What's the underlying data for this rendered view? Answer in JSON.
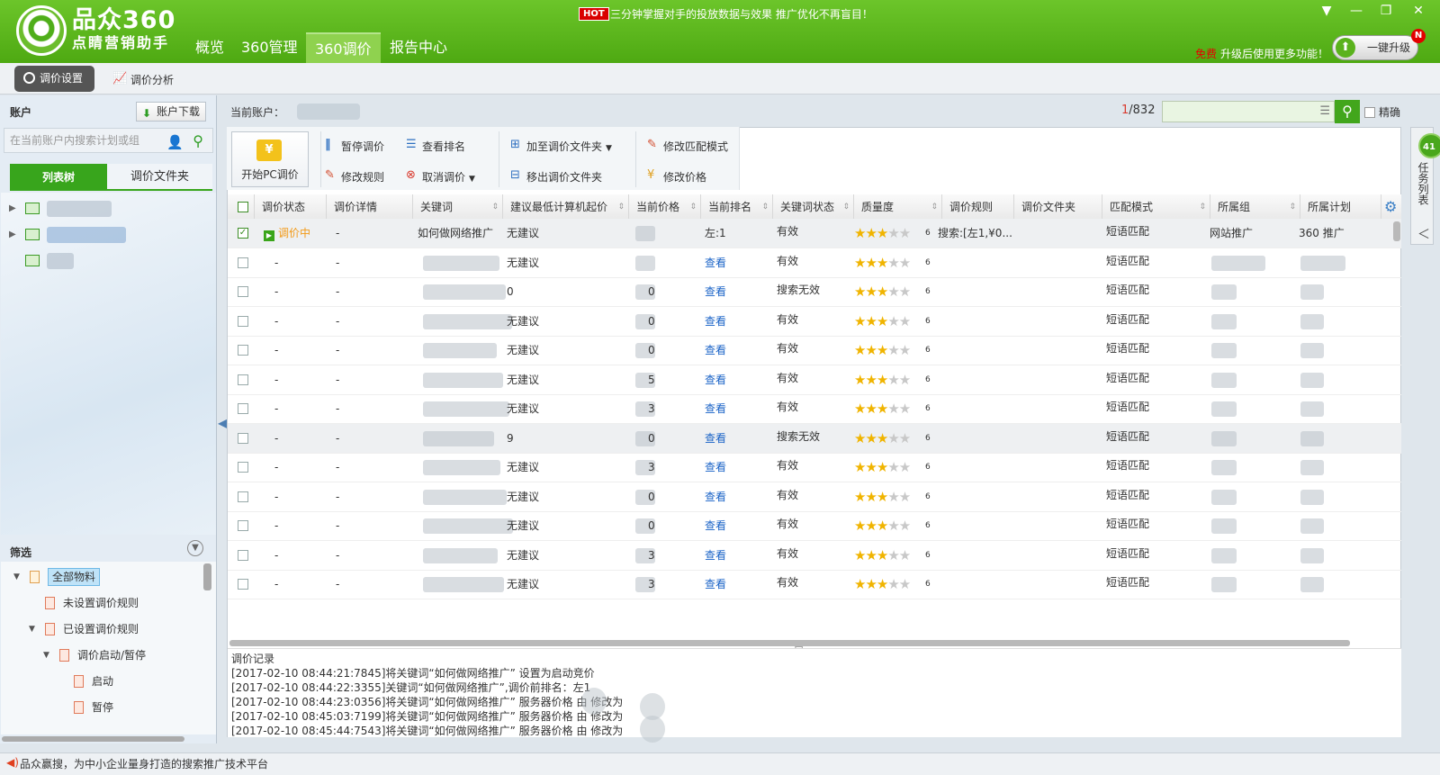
{
  "app": {
    "brand_name": "品众360",
    "brand_sub": "点睛营销助手",
    "nav_tabs": [
      "概览",
      "360管理",
      "360调价",
      "报告中心"
    ],
    "hot_badge": "HOT",
    "hot_text": "三分钟掌握对手的投放数据与效果  推广优化不再盲目！",
    "free_label": "免费",
    "upgrade_text": "升级后使用更多功能！",
    "upgrade_button": "一键升级",
    "upgrade_badge": "N"
  },
  "subtabs": [
    "调价设置",
    "调价分析"
  ],
  "left": {
    "account_title": "账户",
    "download_button": "账户下载",
    "search_placeholder": "在当前账户内搜索计划或组",
    "tab_list": "列表树",
    "tab_folder": "调价文件夹",
    "filter_title": "筛选",
    "filter_items": [
      {
        "label": "全部物料"
      },
      {
        "label": "未设置调价规则"
      },
      {
        "label": "已设置调价规则"
      },
      {
        "label": "调价启动/暂停"
      },
      {
        "label": "启动"
      },
      {
        "label": "暂停"
      }
    ]
  },
  "main": {
    "current_account_label": "当前账户：",
    "page_current": "1",
    "page_total": "/832",
    "precise_label": "精确",
    "toolbar": {
      "start_pc": "开始PC调价",
      "pause": "暂停调价",
      "view_rank": "查看排名",
      "add_folder": "加至调价文件夹",
      "modify_match": "修改匹配模式",
      "modify_rule": "修改规则",
      "cancel": "取消调价",
      "remove_folder": "移出调价文件夹",
      "modify_price": "修改价格"
    },
    "columns": [
      "调价状态",
      "调价详情",
      "关键词",
      "建议最低计算机起价",
      "当前价格",
      "当前排名",
      "关键词状态",
      "质量度",
      "调价规则",
      "调价文件夹",
      "匹配模式",
      "所属组",
      "所属计划"
    ],
    "rows": [
      {
        "checked": true,
        "status": "调价中",
        "detail": "-",
        "keyword": "如何做网络推广",
        "suggest": "无建议",
        "price": "",
        "rank": "左:1",
        "kw_state": "有效",
        "quality": 3,
        "q_num": "6",
        "rule": "搜索:[左1,¥0...",
        "match": "短语匹配",
        "group": "网站推广",
        "plan": "360 推广"
      },
      {
        "checked": false,
        "status": "-",
        "detail": "-",
        "keyword": "",
        "suggest": "无建议",
        "price": "",
        "rank": "查看",
        "kw_state": "有效",
        "quality": 3,
        "q_num": "6",
        "rule": "",
        "match": "短语匹配",
        "group": "",
        "plan": ""
      },
      {
        "checked": false,
        "status": "-",
        "detail": "-",
        "keyword": "",
        "suggest": "0",
        "price": "0",
        "rank": "查看",
        "kw_state": "搜索无效",
        "quality": 3,
        "q_num": "6",
        "rule": "",
        "match": "短语匹配",
        "group": "",
        "plan": ""
      },
      {
        "checked": false,
        "status": "-",
        "detail": "-",
        "keyword": "",
        "suggest": "无建议",
        "price": "0",
        "rank": "查看",
        "kw_state": "有效",
        "quality": 3,
        "q_num": "6",
        "rule": "",
        "match": "短语匹配",
        "group": "",
        "plan": ""
      },
      {
        "checked": false,
        "status": "-",
        "detail": "-",
        "keyword": "",
        "suggest": "无建议",
        "price": "0",
        "rank": "查看",
        "kw_state": "有效",
        "quality": 3,
        "q_num": "6",
        "rule": "",
        "match": "短语匹配",
        "group": "",
        "plan": ""
      },
      {
        "checked": false,
        "status": "-",
        "detail": "-",
        "keyword": "",
        "suggest": "无建议",
        "price": "5",
        "rank": "查看",
        "kw_state": "有效",
        "quality": 3,
        "q_num": "6",
        "rule": "",
        "match": "短语匹配",
        "group": "",
        "plan": ""
      },
      {
        "checked": false,
        "status": "-",
        "detail": "-",
        "keyword": "",
        "suggest": "无建议",
        "price": "3",
        "rank": "查看",
        "kw_state": "有效",
        "quality": 3,
        "q_num": "6",
        "rule": "",
        "match": "短语匹配",
        "group": "",
        "plan": ""
      },
      {
        "checked": false,
        "status": "-",
        "detail": "-",
        "keyword": "",
        "suggest": "9",
        "price": "0",
        "rank": "查看",
        "kw_state": "搜索无效",
        "quality": 3,
        "q_num": "6",
        "rule": "",
        "match": "短语匹配",
        "group": "",
        "plan": ""
      },
      {
        "checked": false,
        "status": "-",
        "detail": "-",
        "keyword": "",
        "suggest": "无建议",
        "price": "3",
        "rank": "查看",
        "kw_state": "有效",
        "quality": 3,
        "q_num": "6",
        "rule": "",
        "match": "短语匹配",
        "group": "",
        "plan": ""
      },
      {
        "checked": false,
        "status": "-",
        "detail": "-",
        "keyword": "",
        "suggest": "无建议",
        "price": "0",
        "rank": "查看",
        "kw_state": "有效",
        "quality": 3,
        "q_num": "6",
        "rule": "",
        "match": "短语匹配",
        "group": "",
        "plan": ""
      },
      {
        "checked": false,
        "status": "-",
        "detail": "-",
        "keyword": "",
        "suggest": "无建议",
        "price": "0",
        "rank": "查看",
        "kw_state": "有效",
        "quality": 3,
        "q_num": "6",
        "rule": "",
        "match": "短语匹配",
        "group": "",
        "plan": ""
      },
      {
        "checked": false,
        "status": "-",
        "detail": "-",
        "keyword": "",
        "suggest": "无建议",
        "price": "3",
        "rank": "查看",
        "kw_state": "有效",
        "quality": 3,
        "q_num": "6",
        "rule": "",
        "match": "短语匹配",
        "group": "",
        "plan": ""
      },
      {
        "checked": false,
        "status": "-",
        "detail": "-",
        "keyword": "",
        "suggest": "无建议",
        "price": "3",
        "rank": "查看",
        "kw_state": "有效",
        "quality": 3,
        "q_num": "6",
        "rule": "",
        "match": "短语匹配",
        "group": "",
        "plan": ""
      }
    ],
    "log_title": "调价记录",
    "log_lines": [
      "[2017-02-10 08:44:21:7845]将关键词“如何做网络推广” 设置为启动竞价",
      "[2017-02-10 08:44:22:3355]关键词“如何做网络推广”,调价前排名：左1",
      "[2017-02-10 08:44:23:0356]将关键词“如何做网络推广” 服务器价格 由     修改为",
      "[2017-02-10 08:45:03:7199]将关键词“如何做网络推广” 服务器价格 由     修改为",
      "[2017-02-10 08:45:44:7543]将关键词“如何做网络推广” 服务器价格 由     修改为"
    ]
  },
  "task_panel": {
    "count": "41",
    "label": "任务列表"
  },
  "status_bar": "品众赢搜，为中小企业量身打造的搜索推广技术平台"
}
